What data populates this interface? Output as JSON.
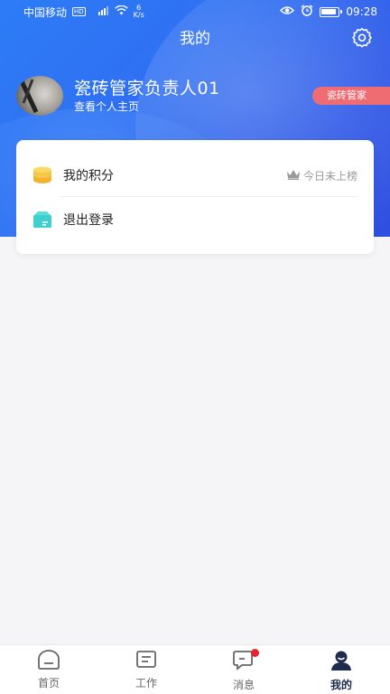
{
  "status_bar": {
    "carrier": "中国移动",
    "hd": "HD",
    "signal": "4G",
    "net_speed_value": "6",
    "net_speed_unit": "K/s",
    "time": "09:28"
  },
  "header": {
    "title": "我的"
  },
  "profile": {
    "name": "瓷砖管家负责人01",
    "view_home_link": "查看个人主页",
    "role_badge": "瓷砖管家"
  },
  "menu": {
    "points_label": "我的积分",
    "points_status": "今日未上榜",
    "logout_label": "退出登录"
  },
  "tabbar": {
    "items": [
      {
        "label": "首页",
        "icon": "home-icon"
      },
      {
        "label": "工作",
        "icon": "work-icon"
      },
      {
        "label": "消息",
        "icon": "message-icon"
      },
      {
        "label": "我的",
        "icon": "profile-icon"
      }
    ],
    "active_index": 3
  },
  "colors": {
    "hero_blue": "#2f6ff2",
    "badge_red": "#ef6c73",
    "coin_yellow": "#f5c342",
    "logout_teal": "#3ecfcf",
    "active_tab": "#1e2b4f",
    "notification_dot": "#e8232f"
  }
}
